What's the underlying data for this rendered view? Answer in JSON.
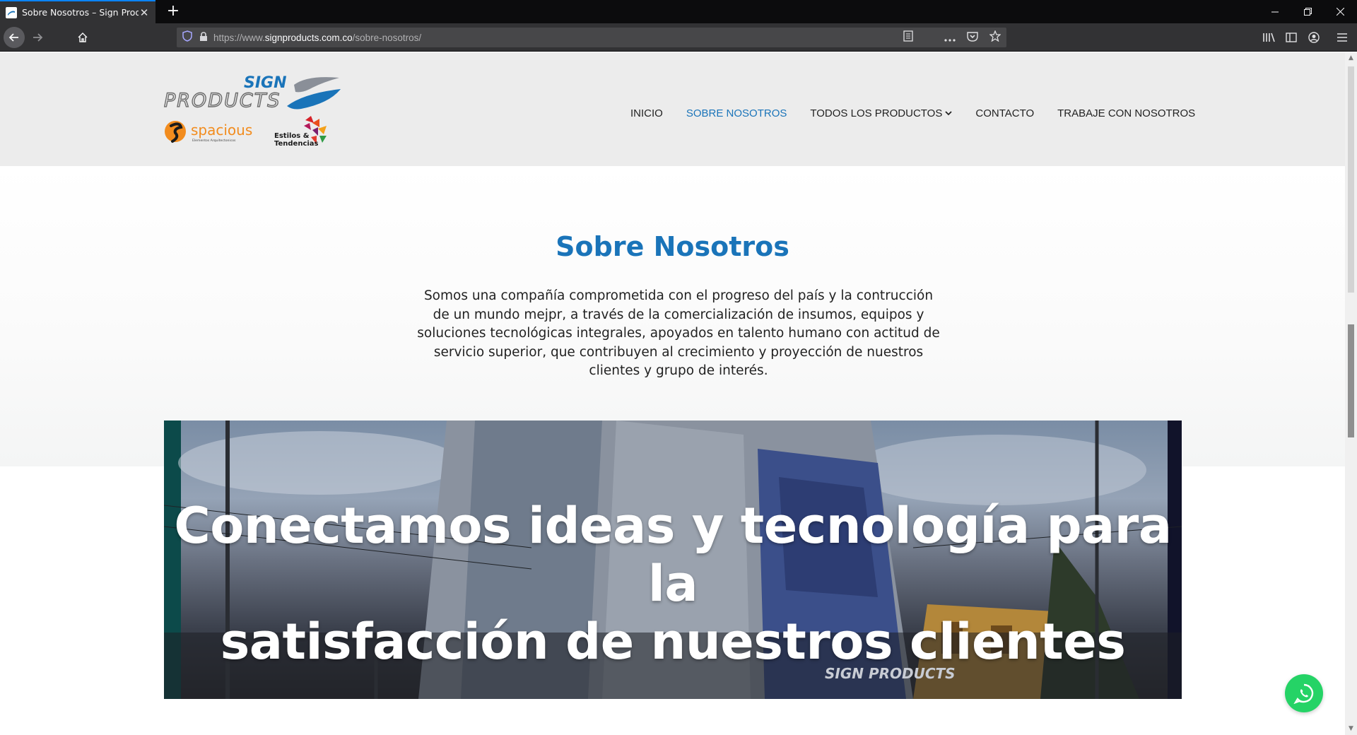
{
  "browser": {
    "tab_title": "Sobre Nosotros – Sign Products",
    "new_tab_label": "+",
    "url_prefix": "https://www.",
    "url_host": "signproducts.com.co",
    "url_path": "/sobre-nosotros/"
  },
  "logos": {
    "sign_word": "SIGN",
    "products_word": "PRODUCTS",
    "spacious_word": "spacious",
    "spacious_tagline": "Elementos Arquitectonicos",
    "estilos_line1": "Estilos &",
    "estilos_line2": "Tendencias"
  },
  "nav": {
    "items": [
      {
        "label": "INICIO"
      },
      {
        "label": "SOBRE NOSOTROS"
      },
      {
        "label": "TODOS LOS PRODUCTOS"
      },
      {
        "label": "CONTACTO"
      },
      {
        "label": "TRABAJE CON NOSOTROS"
      }
    ]
  },
  "about": {
    "title": "Sobre Nosotros",
    "body": "Somos una compañía comprometida con el progreso del país y la contrucción de un mundo mejpr, a través de la comercialización de insumos, equipos y soluciones tecnológicas integrales, apoyados en talento humano con actitud de servicio superior, que contribuyen al crecimiento y proyección de nuestros clientes y grupo de interés."
  },
  "hero": {
    "line1": "Conectamos ideas y tecnología para la",
    "line2": "satisfacción de nuestros clientes",
    "building_sign": "SIGN PRODUCTS"
  },
  "colors": {
    "brand_blue": "#1a74b9",
    "whatsapp_green": "#25d366"
  }
}
